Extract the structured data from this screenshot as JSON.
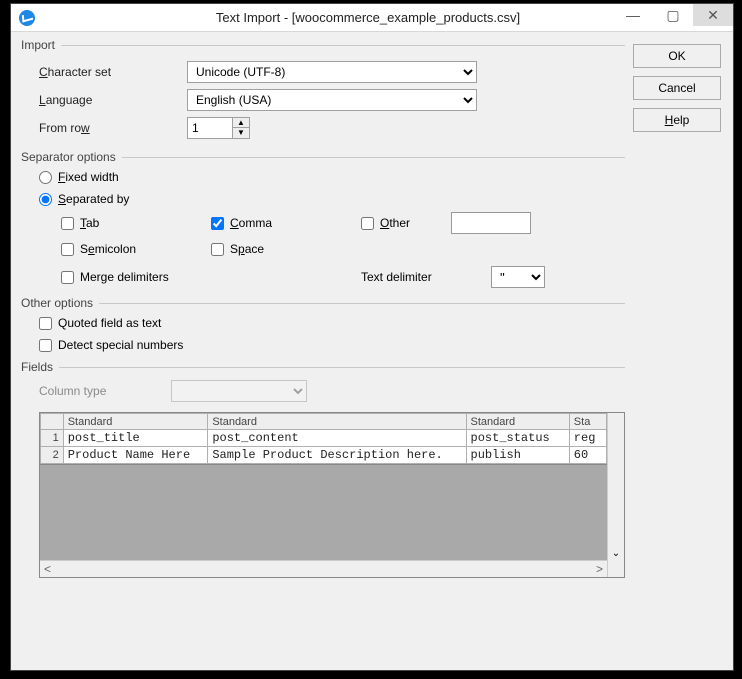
{
  "title": "Text Import - [woocommerce_example_products.csv]",
  "buttons": {
    "ok": "OK",
    "cancel": "Cancel",
    "help": "Help"
  },
  "import": {
    "legend": "Import",
    "charset_label": "Character set",
    "charset_value": "Unicode (UTF-8)",
    "language_label": "Language",
    "language_value": "English (USA)",
    "fromrow_label": "From row",
    "fromrow_value": "1"
  },
  "sep": {
    "legend": "Separator options",
    "fixed": "Fixed width",
    "separated": "Separated by",
    "tab": "Tab",
    "comma": "Comma",
    "other": "Other",
    "semicolon": "Semicolon",
    "space": "Space",
    "merge": "Merge delimiters",
    "textdelim_label": "Text delimiter",
    "textdelim_value": "\"",
    "checked": {
      "tab": false,
      "comma": true,
      "other": false,
      "semicolon": false,
      "space": false,
      "merge": false
    },
    "mode": "separated",
    "other_value": ""
  },
  "other": {
    "legend": "Other options",
    "quoted": "Quoted field as text",
    "detect": "Detect special numbers",
    "checked": {
      "quoted": false,
      "detect": false
    }
  },
  "fields": {
    "legend": "Fields",
    "coltype_label": "Column type",
    "coltype_value": "",
    "headers": [
      "Standard",
      "Standard",
      "Standard",
      "Sta"
    ],
    "rows": [
      {
        "n": "1",
        "cells": [
          "post_title",
          "post_content",
          "post_status",
          "reg"
        ]
      },
      {
        "n": "2",
        "cells": [
          "Product Name Here",
          "Sample Product Description here.",
          "publish",
          "60"
        ]
      }
    ]
  }
}
